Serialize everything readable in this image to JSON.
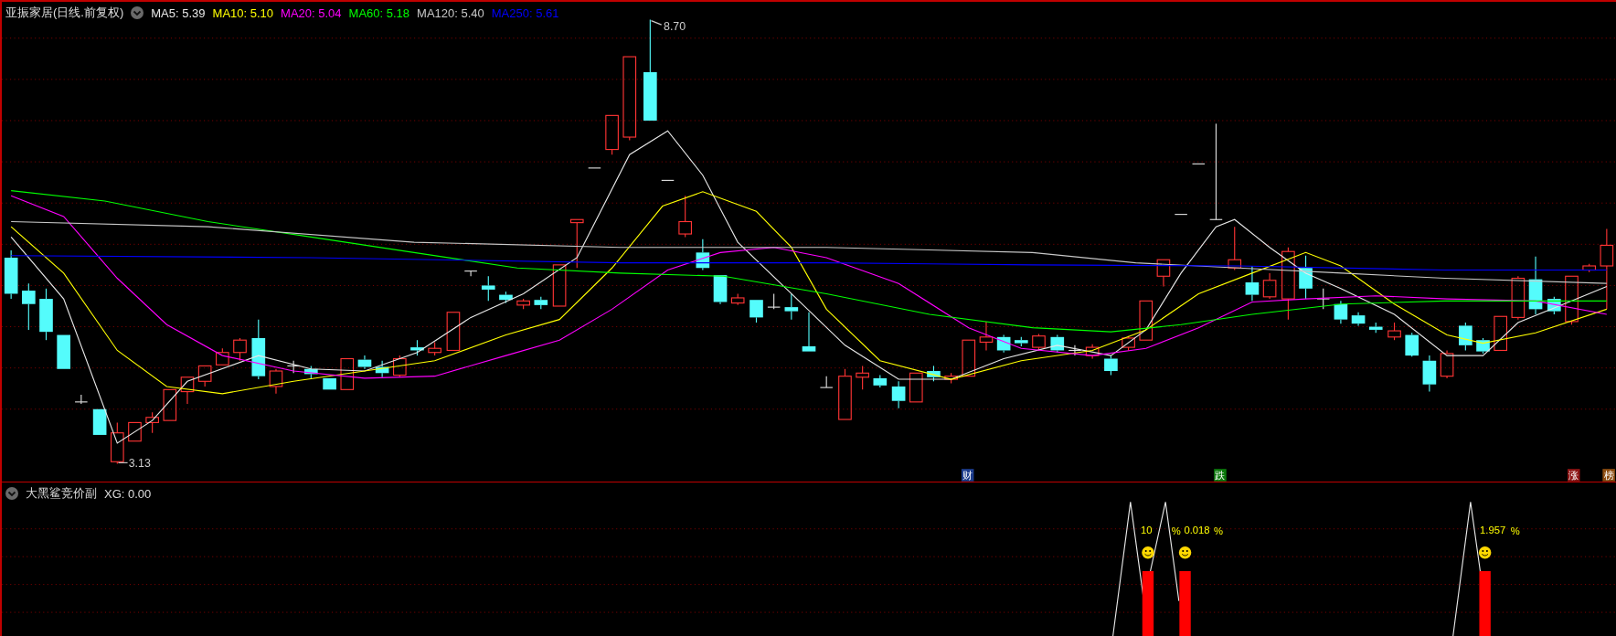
{
  "stock": {
    "title": "亚振家居(日线.前复权)",
    "moving_averages": [
      {
        "label": "MA5: 5.39",
        "color": "#e8e8e8"
      },
      {
        "label": "MA10: 5.10",
        "color": "#ffff00"
      },
      {
        "label": "MA20: 5.04",
        "color": "#ff00ff"
      },
      {
        "label": "MA60: 5.18",
        "color": "#00ff00"
      },
      {
        "label": "MA120: 5.40",
        "color": "#c8c8c8"
      },
      {
        "label": "MA250: 5.61",
        "color": "#0000ff"
      }
    ]
  },
  "price_labels": {
    "high": "8.70",
    "low": "3.13"
  },
  "event_markers": [
    {
      "label": "财",
      "color": "#1c3c8c"
    },
    {
      "label": "跌",
      "color": "#0c7a0c"
    },
    {
      "label": "涨",
      "color": "#8c1414"
    },
    {
      "label": "榜",
      "color": "#8c4c10"
    }
  ],
  "indicator": {
    "title": "大黑鲨竞价副",
    "reading": "XG: 0.00",
    "signals": [
      {
        "value": "10",
        "unit": "%"
      },
      {
        "value": "0.018",
        "unit": "%"
      },
      {
        "value": "1.957",
        "unit": "%"
      }
    ]
  }
}
